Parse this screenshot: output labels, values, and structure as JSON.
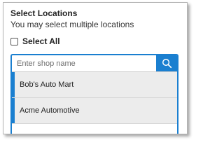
{
  "header": {
    "title": "Select Locations",
    "subtitle": "You may select multiple locations"
  },
  "select_all": {
    "label": "Select All",
    "checked": false
  },
  "search": {
    "placeholder": "Enter shop name",
    "value": "",
    "button_icon": "search-icon"
  },
  "locations": [
    {
      "label": "Bob's Auto Mart"
    },
    {
      "label": "Acme Automotive"
    }
  ],
  "colors": {
    "accent": "#1a7fd0",
    "item_background": "#ececec"
  }
}
